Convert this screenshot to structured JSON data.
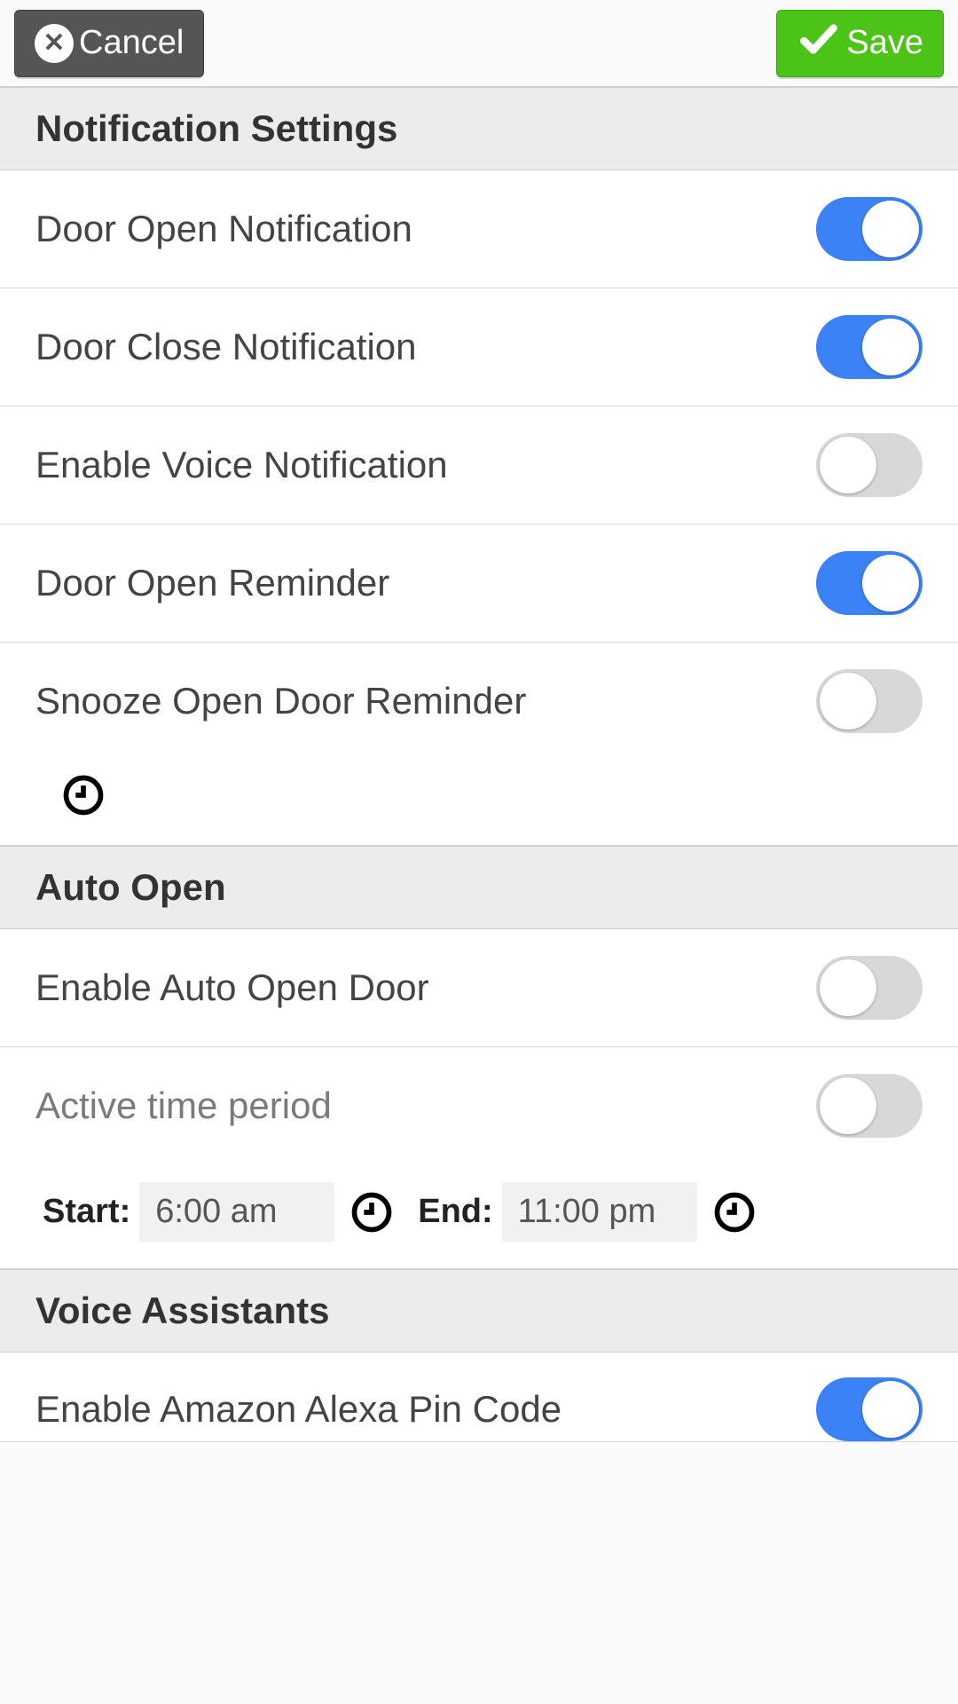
{
  "header": {
    "cancel_label": "Cancel",
    "save_label": "Save"
  },
  "sections": {
    "notification": {
      "title": "Notification Settings",
      "door_open_notification": {
        "label": "Door Open Notification",
        "on": true
      },
      "door_close_notification": {
        "label": "Door Close Notification",
        "on": true
      },
      "enable_voice_notification": {
        "label": "Enable Voice Notification",
        "on": false
      },
      "door_open_reminder": {
        "label": "Door Open Reminder",
        "on": true
      },
      "snooze_open_door_reminder": {
        "label": "Snooze Open Door Reminder",
        "on": false
      }
    },
    "auto_open": {
      "title": "Auto Open",
      "enable_auto_open": {
        "label": "Enable Auto Open Door",
        "on": false
      },
      "active_time_period": {
        "label": "Active time period",
        "on": false
      },
      "start_label": "Start:",
      "start_value": "6:00 am",
      "end_label": "End:",
      "end_value": "11:00 pm"
    },
    "voice_assistants": {
      "title": "Voice Assistants",
      "enable_alexa_pin": {
        "label": "Enable Amazon Alexa Pin Code",
        "on": true
      }
    }
  }
}
